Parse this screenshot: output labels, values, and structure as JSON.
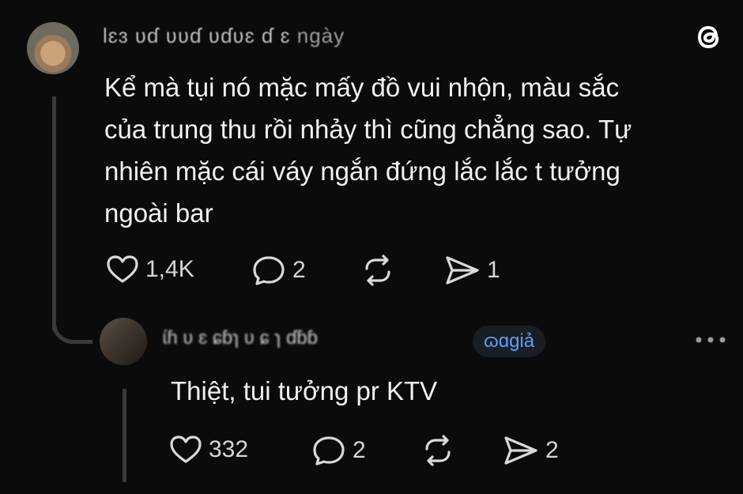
{
  "post": {
    "username_obscured": "lɛɜ ʋɗ ʋʋɗ ʋɗʋɛ ɗ ɛ",
    "time_suffix": "ngày",
    "text": "Kể mà tụi nó mặc mấy đồ vui nhộn, màu sắc\ncủa trung thu rồi nhảy thì cũng chẳng sao. Tự\nnhiên mặc cái váy ngắn đứng lắc lắc t tưởng\nngoài bar",
    "likes": "1,4K",
    "comments": "2",
    "shares": "1"
  },
  "reply": {
    "username_obscured": "ɩ́ɦ ʋ ɛ ɕɓɿ ʋ ɕ ɿ ɗɓɓ",
    "time_suffix": "ɷɑgiả",
    "text": "Thiệt, tui tưởng pr KTV",
    "likes": "332",
    "comments": "2",
    "shares": "2"
  },
  "icons": {
    "app_logo": "threads-logo-icon",
    "like": "heart-icon",
    "comment": "speech-bubble-icon",
    "repost": "repost-icon",
    "share": "send-icon",
    "more": "more-dots-icon"
  },
  "colors": {
    "background": "#0b0b0b",
    "text": "#f1f1f1",
    "muted": "#bdbdbd",
    "accent": "#5aa0ff"
  }
}
